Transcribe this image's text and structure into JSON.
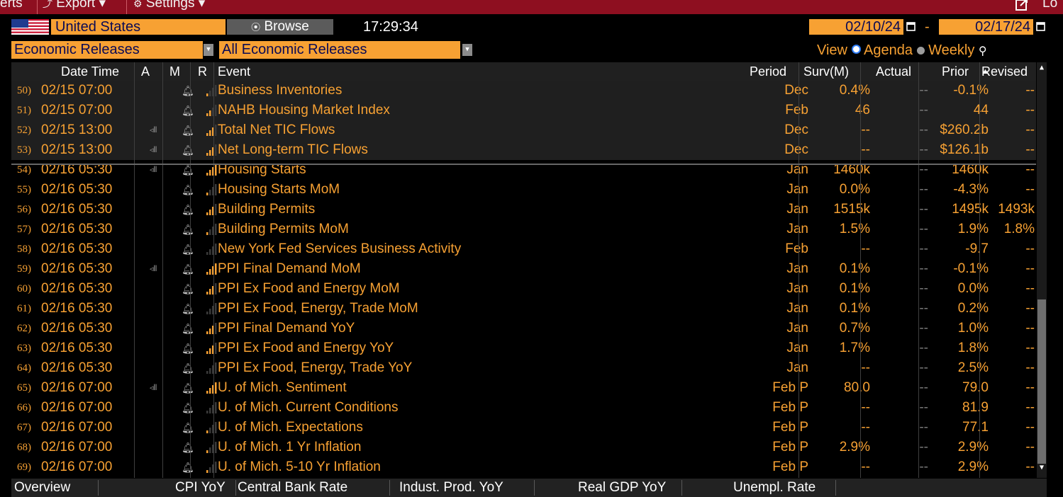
{
  "topbar": {
    "alerts": "erts",
    "export": "Export ▾",
    "settings": "Settings ▾",
    "right": "Lo"
  },
  "header": {
    "country": "United States",
    "browse": "Browse",
    "clock": "17:29:34",
    "date_from": "02/10/24",
    "date_sep": "-",
    "date_to": "02/17/24",
    "category": "Economic Releases",
    "release_filter": "All Economic Releases",
    "view_label": "View",
    "agenda_label": "Agenda",
    "weekly_label": "Weekly"
  },
  "columns": {
    "date_time": "Date Time",
    "a": "A",
    "m": "M",
    "r": "R",
    "event": "Event",
    "period": "Period",
    "surv": "Surv(M)",
    "actual": "Actual",
    "prior": "Prior",
    "revised": "Revised"
  },
  "rows": [
    {
      "num": "50)",
      "dt": "02/15 07:00",
      "audio": false,
      "bars": 1,
      "event": "Business Inventories",
      "period": "Dec",
      "surv": "0.4%",
      "actual": "--",
      "prior": "-0.1%",
      "revised": "--",
      "hl": true
    },
    {
      "num": "51)",
      "dt": "02/15 07:00",
      "audio": false,
      "bars": 2,
      "event": "NAHB Housing Market Index",
      "period": "Feb",
      "surv": "46",
      "actual": "--",
      "prior": "44",
      "revised": "--",
      "hl": true
    },
    {
      "num": "52)",
      "dt": "02/15 13:00",
      "audio": true,
      "bars": 3,
      "event": "Total Net TIC Flows",
      "period": "Dec",
      "surv": "--",
      "actual": "--",
      "prior": "$260.2b",
      "revised": "--",
      "hl": true
    },
    {
      "num": "53)",
      "dt": "02/15 13:00",
      "audio": true,
      "bars": 3,
      "event": "Net Long-term TIC Flows",
      "period": "Dec",
      "surv": "--",
      "actual": "--",
      "prior": "$126.1b",
      "revised": "--",
      "hl": true
    },
    {
      "num": "54)",
      "dt": "02/16 05:30",
      "audio": true,
      "bars": 4,
      "event": "Housing Starts",
      "period": "Jan",
      "surv": "1460k",
      "actual": "--",
      "prior": "1460k",
      "revised": "--",
      "hl": false
    },
    {
      "num": "55)",
      "dt": "02/16 05:30",
      "audio": false,
      "bars": 1,
      "event": "Housing Starts MoM",
      "period": "Jan",
      "surv": "0.0%",
      "actual": "--",
      "prior": "-4.3%",
      "revised": "--",
      "hl": false
    },
    {
      "num": "56)",
      "dt": "02/16 05:30",
      "audio": false,
      "bars": 3,
      "event": "Building Permits",
      "period": "Jan",
      "surv": "1515k",
      "actual": "--",
      "prior": "1495k",
      "revised": "1493k",
      "hl": false
    },
    {
      "num": "57)",
      "dt": "02/16 05:30",
      "audio": false,
      "bars": 1,
      "event": "Building Permits MoM",
      "period": "Jan",
      "surv": "1.5%",
      "actual": "--",
      "prior": "1.9%",
      "revised": "1.8%",
      "hl": false
    },
    {
      "num": "58)",
      "dt": "02/16 05:30",
      "audio": false,
      "bars": 0,
      "event": "New York Fed Services Business Activity",
      "period": "Feb",
      "surv": "--",
      "actual": "--",
      "prior": "-9.7",
      "revised": "--",
      "hl": false
    },
    {
      "num": "59)",
      "dt": "02/16 05:30",
      "audio": true,
      "bars": 4,
      "event": "PPI Final Demand MoM",
      "period": "Jan",
      "surv": "0.1%",
      "actual": "--",
      "prior": "-0.1%",
      "revised": "--",
      "hl": false
    },
    {
      "num": "60)",
      "dt": "02/16 05:30",
      "audio": false,
      "bars": 3,
      "event": "PPI Ex Food and Energy MoM",
      "period": "Jan",
      "surv": "0.1%",
      "actual": "--",
      "prior": "0.0%",
      "revised": "--",
      "hl": false
    },
    {
      "num": "61)",
      "dt": "02/16 05:30",
      "audio": false,
      "bars": 0,
      "event": "PPI Ex Food, Energy, Trade MoM",
      "period": "Jan",
      "surv": "0.1%",
      "actual": "--",
      "prior": "0.2%",
      "revised": "--",
      "hl": false
    },
    {
      "num": "62)",
      "dt": "02/16 05:30",
      "audio": false,
      "bars": 3,
      "event": "PPI Final Demand YoY",
      "period": "Jan",
      "surv": "0.7%",
      "actual": "--",
      "prior": "1.0%",
      "revised": "--",
      "hl": false
    },
    {
      "num": "63)",
      "dt": "02/16 05:30",
      "audio": false,
      "bars": 3,
      "event": "PPI Ex Food and Energy YoY",
      "period": "Jan",
      "surv": "1.7%",
      "actual": "--",
      "prior": "1.8%",
      "revised": "--",
      "hl": false
    },
    {
      "num": "64)",
      "dt": "02/16 05:30",
      "audio": false,
      "bars": 0,
      "event": "PPI Ex Food, Energy, Trade YoY",
      "period": "Jan",
      "surv": "--",
      "actual": "--",
      "prior": "2.5%",
      "revised": "--",
      "hl": false
    },
    {
      "num": "65)",
      "dt": "02/16 07:00",
      "audio": true,
      "bars": 4,
      "event": "U. of Mich. Sentiment",
      "period": "Feb P",
      "surv": "80.0",
      "actual": "--",
      "prior": "79.0",
      "revised": "--",
      "hl": false
    },
    {
      "num": "66)",
      "dt": "02/16 07:00",
      "audio": false,
      "bars": 0,
      "event": "U. of Mich. Current Conditions",
      "period": "Feb P",
      "surv": "--",
      "actual": "--",
      "prior": "81.9",
      "revised": "--",
      "hl": false
    },
    {
      "num": "67)",
      "dt": "02/16 07:00",
      "audio": false,
      "bars": 1,
      "event": "U. of Mich. Expectations",
      "period": "Feb P",
      "surv": "--",
      "actual": "--",
      "prior": "77.1",
      "revised": "--",
      "hl": false
    },
    {
      "num": "68)",
      "dt": "02/16 07:00",
      "audio": false,
      "bars": 1,
      "event": "U. of Mich. 1 Yr Inflation",
      "period": "Feb P",
      "surv": "2.9%",
      "actual": "--",
      "prior": "2.9%",
      "revised": "--",
      "hl": false
    },
    {
      "num": "69)",
      "dt": "02/16 07:00",
      "audio": false,
      "bars": 1,
      "event": "U. of Mich. 5-10 Yr Inflation",
      "period": "Feb P",
      "surv": "--",
      "actual": "--",
      "prior": "2.9%",
      "revised": "--",
      "hl": false
    }
  ],
  "bottom": {
    "overview": "Overview",
    "cpi": "CPI YoY",
    "cbr": "Central Bank Rate",
    "ip": "Indust. Prod. YoY",
    "gdp": "Real GDP YoY",
    "unemp": "Unempl. Rate"
  },
  "colors": {
    "accent": "#f7a133",
    "topbar": "#8e0f20",
    "bar_on": "#f7a133",
    "bar_off": "#3a3a3a"
  }
}
